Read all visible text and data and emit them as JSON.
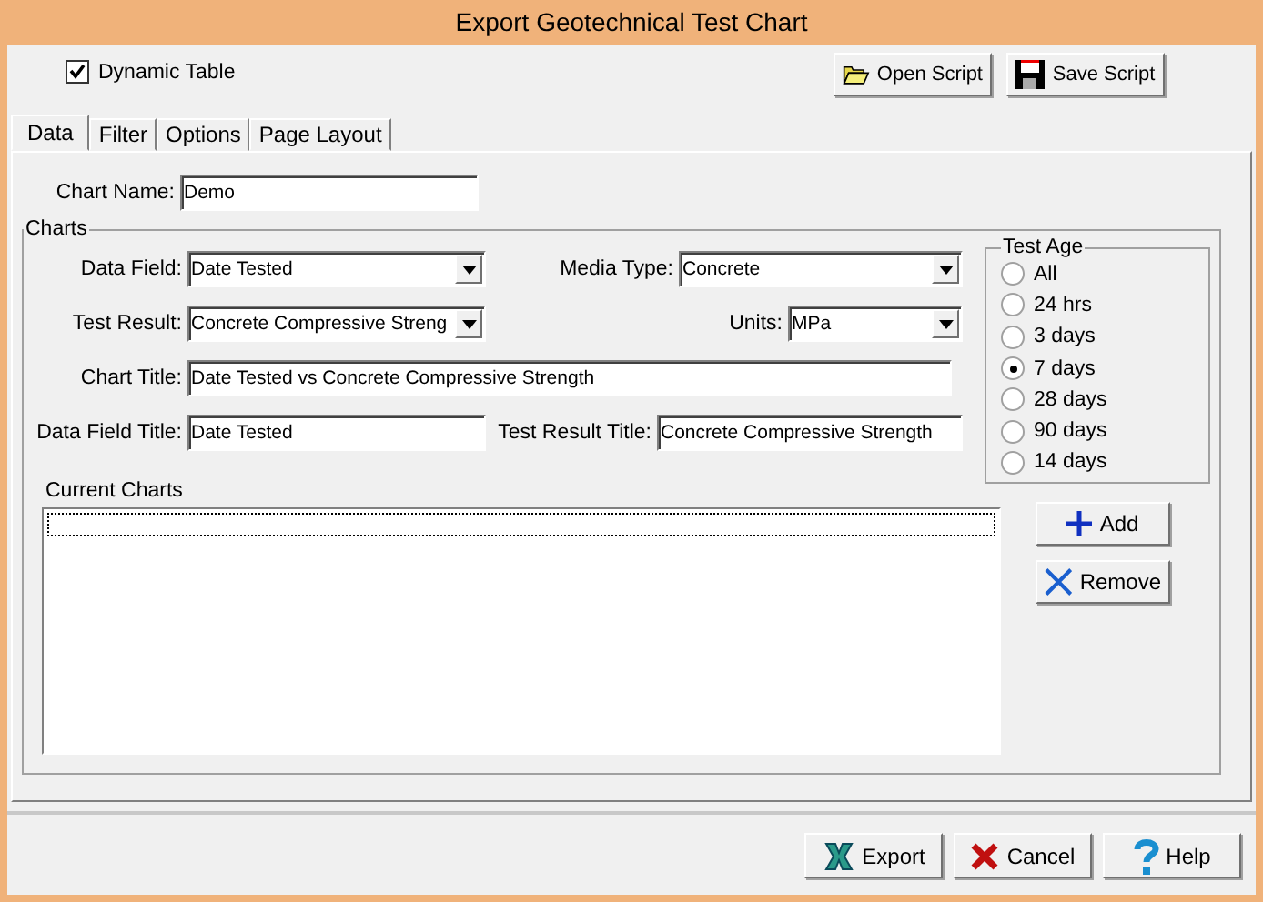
{
  "window": {
    "title": "Export Geotechnical Test Chart"
  },
  "dynamic_table": {
    "label": "Dynamic Table",
    "checked": true
  },
  "script_buttons": [
    {
      "label": "Open Script",
      "kind": "open"
    },
    {
      "label": "Save Script",
      "kind": "save"
    }
  ],
  "tabs": [
    {
      "label": "Data",
      "selected": true
    },
    {
      "label": "Filter",
      "selected": false
    },
    {
      "label": "Options",
      "selected": false
    },
    {
      "label": "Page Layout",
      "selected": false
    }
  ],
  "chart_name": {
    "label": "Chart Name:",
    "value": "Demo"
  },
  "charts": {
    "title": "Charts",
    "rows": [
      [
        {
          "label": "Data Field:",
          "value": "Date Tested",
          "kind": "dropdown"
        },
        {
          "label": "Media Type:",
          "value": "Concrete",
          "kind": "dropdown"
        }
      ],
      [
        {
          "label": "Test Result:",
          "value": "Concrete Compressive Streng",
          "kind": "dropdown"
        },
        {
          "label": "Units:",
          "value": "MPa",
          "kind": "dropdown"
        }
      ],
      [
        {
          "label": "Chart Title:",
          "value": "Date Tested vs Concrete Compressive Strength",
          "kind": "text"
        }
      ],
      [
        {
          "label": "Data Field Title:",
          "value": "Date Tested",
          "kind": "text"
        },
        {
          "label": "Test Result Title:",
          "value": "Concrete Compressive Strength",
          "kind": "text"
        }
      ]
    ],
    "test_age": {
      "title": "Test Age",
      "options": [
        {
          "label": "All",
          "selected": false
        },
        {
          "label": "24 hrs",
          "selected": false
        },
        {
          "label": "3 days",
          "selected": false
        },
        {
          "label": "7 days",
          "selected": true
        },
        {
          "label": "28 days",
          "selected": false
        },
        {
          "label": "90 days",
          "selected": false
        },
        {
          "label": "14 days",
          "selected": false
        }
      ]
    },
    "current_charts": {
      "label": "Current Charts"
    },
    "list_buttons": [
      {
        "label": "Add",
        "kind": "add"
      },
      {
        "label": "Remove",
        "kind": "remove"
      }
    ]
  },
  "footer_buttons": [
    {
      "label": "Export",
      "kind": "export"
    },
    {
      "label": "Cancel",
      "kind": "cancel"
    },
    {
      "label": "Help",
      "kind": "help"
    }
  ]
}
